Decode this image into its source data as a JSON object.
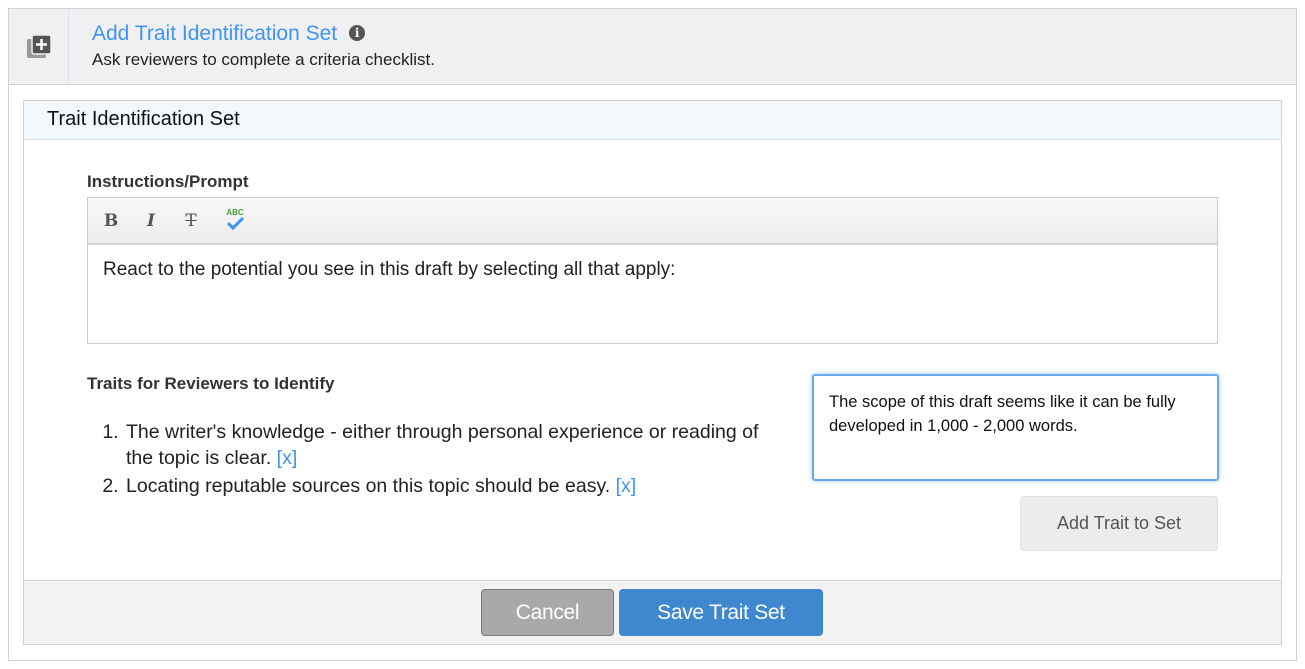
{
  "header": {
    "title": "Add Trait Identification Set",
    "subtitle": "Ask reviewers to complete a criteria checklist.",
    "icon": "add-to-library-icon",
    "info_icon": "info-icon"
  },
  "panel": {
    "title": "Trait Identification Set",
    "instructions_label": "Instructions/Prompt",
    "toolbar": {
      "bold": "B",
      "italic": "I",
      "strike": "T",
      "spellcheck": "ABC"
    },
    "instructions_text": "React to the potential you see in this draft by selecting all that apply:",
    "traits_label": "Traits for Reviewers to Identify",
    "traits": [
      {
        "text": "The writer's knowledge - either through personal experience or reading of the topic is clear.",
        "remove": "[x]"
      },
      {
        "text": "Locating reputable sources on this topic should be easy.",
        "remove": "[x]"
      }
    ],
    "new_trait_value": "The scope of this draft seems like it can be fully developed in 1,000 - 2,000 words.",
    "add_trait_label": "Add Trait to Set"
  },
  "footer": {
    "cancel_label": "Cancel",
    "save_label": "Save Trait Set"
  },
  "colors": {
    "accent": "#3d94f6",
    "save": "#3f88d0",
    "cancel": "#a9a9a9"
  }
}
